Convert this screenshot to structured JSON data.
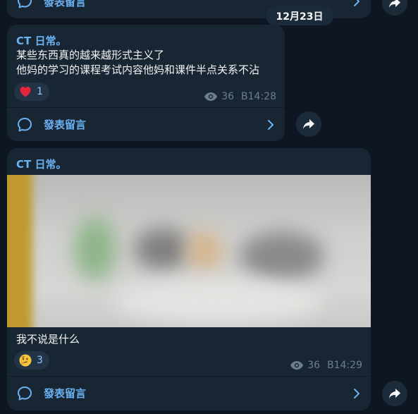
{
  "top_fragment": {
    "comment_label": "發表留言"
  },
  "date_separator": "12月23日",
  "posts": [
    {
      "sender": "CT 日常。",
      "lines": [
        "某些东西真的越来越形式主义了",
        "他妈的学习的课程考试内容他妈和课件半点关系不沾"
      ],
      "reaction_emoji": "heart",
      "reaction_count": "1",
      "views": "36",
      "time": "B14:28",
      "comment_label": "發表留言"
    },
    {
      "sender": "CT 日常。",
      "has_photo": true,
      "caption": "我不说是什么",
      "reaction_emoji": "thinking-face",
      "reaction_count": "3",
      "views": "36",
      "time": "B14:29",
      "comment_label": "發表留言"
    }
  ],
  "colors": {
    "background": "#0e1621",
    "bubble": "#182533",
    "accent": "#6ab3f3",
    "meta": "#6d7f8f"
  }
}
